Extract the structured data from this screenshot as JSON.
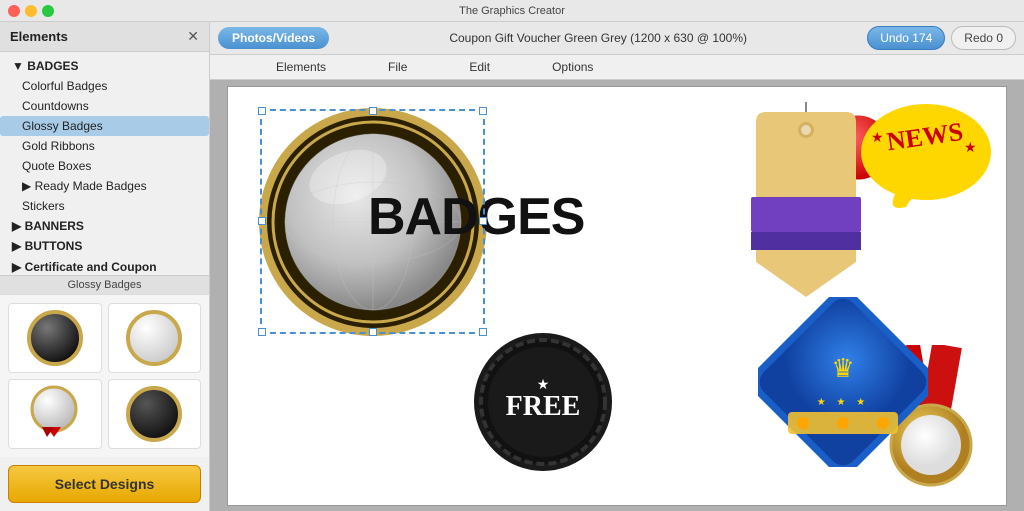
{
  "app": {
    "title": "The Graphics Creator"
  },
  "toolbar": {
    "photos_videos_label": "Photos/Videos",
    "doc_title": "Coupon Gift Voucher Green Grey (1200 x 630 @ 100%)",
    "undo_label": "Undo 174",
    "redo_label": "Redo 0",
    "elements_label": "Elements",
    "file_label": "File",
    "edit_label": "Edit",
    "options_label": "Options"
  },
  "sidebar": {
    "title": "Elements",
    "close_label": "✕",
    "tree": [
      {
        "id": "badges",
        "label": "▼ BADGES",
        "level": 1
      },
      {
        "id": "colorful-badges",
        "label": "Colorful Badges",
        "level": 2
      },
      {
        "id": "countdowns",
        "label": "Countdowns",
        "level": 2
      },
      {
        "id": "glossy-badges",
        "label": "Glossy Badges",
        "level": 2,
        "active": true
      },
      {
        "id": "gold-ribbons",
        "label": "Gold Ribbons",
        "level": 2
      },
      {
        "id": "quote-boxes",
        "label": "Quote Boxes",
        "level": 2
      },
      {
        "id": "ready-made-badges",
        "label": "▶ Ready Made Badges",
        "level": 2
      },
      {
        "id": "stickers",
        "label": "Stickers",
        "level": 2
      },
      {
        "id": "banners",
        "label": "▶ BANNERS",
        "level": 1
      },
      {
        "id": "buttons",
        "label": "▶ BUTTONS",
        "level": 1
      },
      {
        "id": "cert-coupon",
        "label": "▶ Certificate and Coupon Elements",
        "level": 1
      }
    ],
    "bottom_label": "Glossy Badges",
    "select_designs_label": "Select Designs"
  },
  "canvas": {
    "badges_text": "BADGES",
    "free_text": "FREE",
    "news_text": "NEWS"
  }
}
